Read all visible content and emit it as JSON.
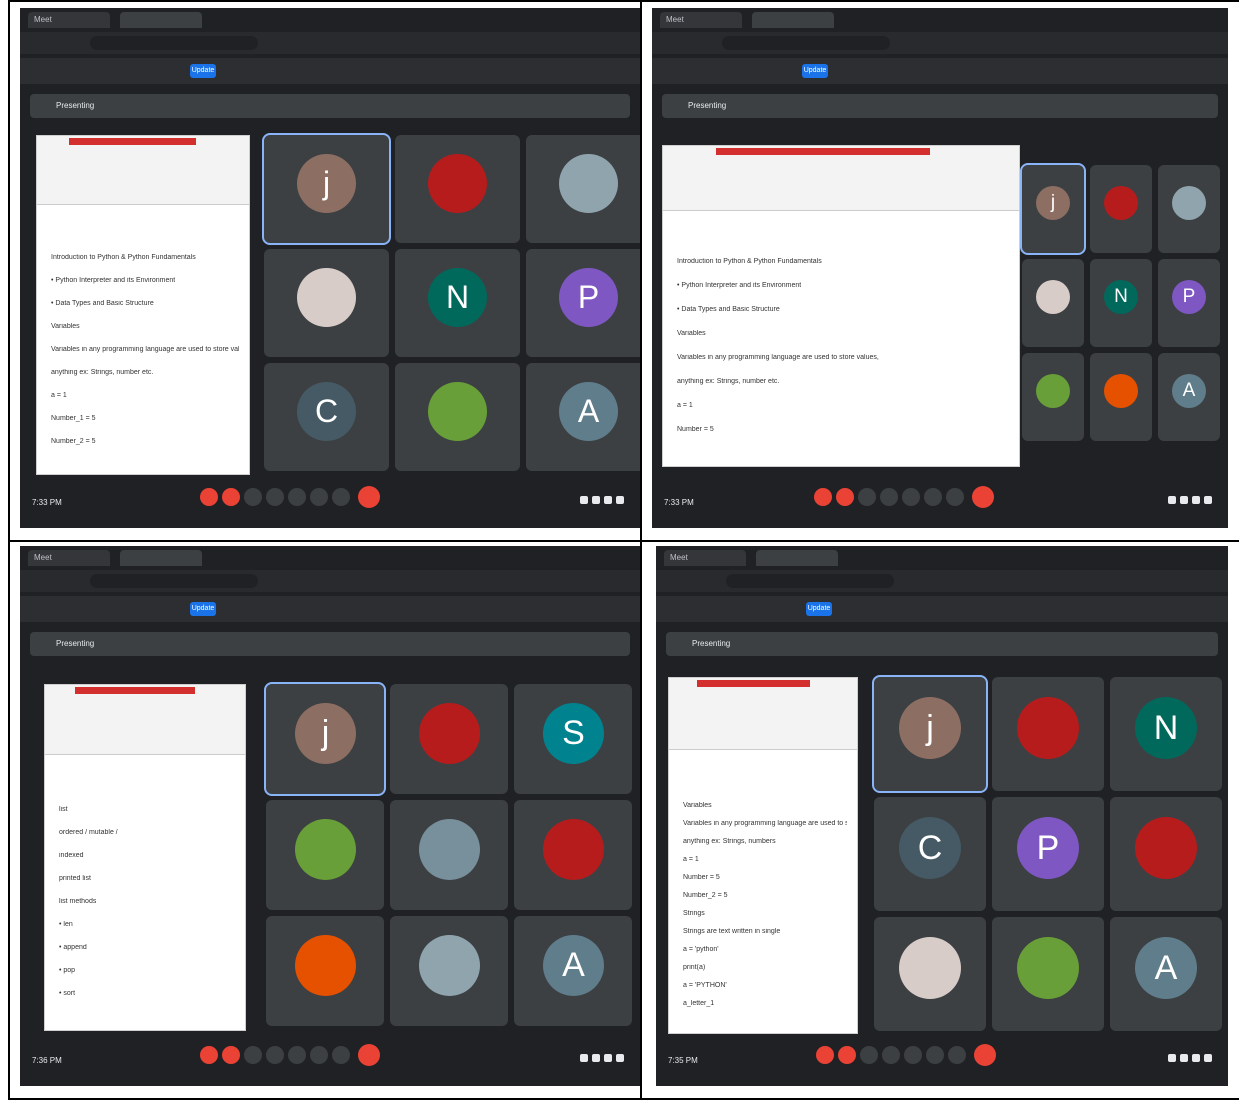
{
  "layout_note": "",
  "panels": [
    {
      "tab_title": "Meet",
      "presenter_label": "Presenting",
      "clock": "7:33 PM",
      "doc_lines": [
        "Introduction to Python & Python Fundamentals",
        "• Python Interpreter and its Environment",
        "• Data Types and Basic Structure",
        "Variables",
        "Variables in any programming language are used to store values —",
        "anything ex: Strings, number etc.",
        "a = 1",
        "Number_1 = 5",
        "Number_2 = 5"
      ],
      "participants": [
        {
          "initial": "j",
          "name": "",
          "color": "#8d6e63"
        },
        {
          "initial": "",
          "name": "",
          "color": "#b71c1c"
        },
        {
          "initial": "",
          "name": "",
          "color": "#90a4ae"
        },
        {
          "initial": "",
          "name": "",
          "color": "#d7ccc8"
        },
        {
          "initial": "N",
          "name": "",
          "color": "#00695c"
        },
        {
          "initial": "P",
          "name": "",
          "color": "#7e57c2"
        },
        {
          "initial": "C",
          "name": "",
          "color": "#455a64"
        },
        {
          "initial": "",
          "name": "",
          "color": "#689f38"
        },
        {
          "initial": "A",
          "name": "",
          "color": "#607d8b"
        }
      ]
    },
    {
      "tab_title": "Meet",
      "presenter_label": "Presenting",
      "clock": "7:33 PM",
      "doc_lines": [
        "Introduction to Python & Python Fundamentals",
        "• Python Interpreter and its Environment",
        "• Data Types and Basic Structure",
        "Variables",
        "Variables in any programming language are used to store values,",
        "anything ex: Strings, number etc.",
        "a = 1",
        "Number = 5"
      ],
      "participants": [
        {
          "initial": "j",
          "name": "",
          "color": "#8d6e63"
        },
        {
          "initial": "",
          "name": "",
          "color": "#b71c1c"
        },
        {
          "initial": "",
          "name": "",
          "color": "#90a4ae"
        },
        {
          "initial": "",
          "name": "",
          "color": "#d7ccc8"
        },
        {
          "initial": "N",
          "name": "",
          "color": "#00695c"
        },
        {
          "initial": "P",
          "name": "",
          "color": "#7e57c2"
        },
        {
          "initial": "",
          "name": "",
          "color": "#689f38"
        },
        {
          "initial": "",
          "name": "",
          "color": "#e65100"
        },
        {
          "initial": "A",
          "name": "",
          "color": "#607d8b"
        }
      ]
    },
    {
      "tab_title": "Meet",
      "presenter_label": "Presenting",
      "clock": "7:36 PM",
      "doc_lines": [
        "list",
        "ordered / mutable / ",
        "indexed",
        "printed list",
        "list methods",
        "• len",
        "• append",
        "• pop",
        "• sort"
      ],
      "participants": [
        {
          "initial": "j",
          "name": "",
          "color": "#8d6e63"
        },
        {
          "initial": "",
          "name": "",
          "color": "#b71c1c"
        },
        {
          "initial": "S",
          "name": "",
          "color": "#00838f"
        },
        {
          "initial": "",
          "name": "",
          "color": "#689f38"
        },
        {
          "initial": "",
          "name": "",
          "color": "#78909c"
        },
        {
          "initial": "",
          "name": "",
          "color": "#b71c1c"
        },
        {
          "initial": "",
          "name": "",
          "color": "#e65100"
        },
        {
          "initial": "",
          "name": "",
          "color": "#90a4ae"
        },
        {
          "initial": "A",
          "name": "",
          "color": "#607d8b"
        }
      ]
    },
    {
      "tab_title": "Meet",
      "presenter_label": "Presenting",
      "clock": "7:35 PM",
      "doc_lines": [
        "Variables",
        "Variables in any programming language are used to store",
        "anything ex: Strings, numbers",
        "a = 1",
        "Number = 5",
        "Number_2 = 5",
        "Strings",
        "Strings are text written in single",
        "a = 'python'",
        "print(a)",
        "a = 'PYTHON'",
        "a_letter_1"
      ],
      "participants": [
        {
          "initial": "j",
          "name": "",
          "color": "#8d6e63"
        },
        {
          "initial": "",
          "name": "",
          "color": "#b71c1c"
        },
        {
          "initial": "N",
          "name": "",
          "color": "#00695c"
        },
        {
          "initial": "C",
          "name": "",
          "color": "#455a64"
        },
        {
          "initial": "P",
          "name": "",
          "color": "#7e57c2"
        },
        {
          "initial": "",
          "name": "",
          "color": "#b71c1c"
        },
        {
          "initial": "",
          "name": "",
          "color": "#d7ccc8"
        },
        {
          "initial": "",
          "name": "",
          "color": "#689f38"
        },
        {
          "initial": "A",
          "name": "",
          "color": "#607d8b"
        }
      ]
    }
  ],
  "update_button_label": "Update",
  "colors": {
    "meet_bg": "#202124",
    "tile_bg": "#3c4043",
    "end_call": "#ea4335",
    "accent": "#8ab4f8"
  }
}
